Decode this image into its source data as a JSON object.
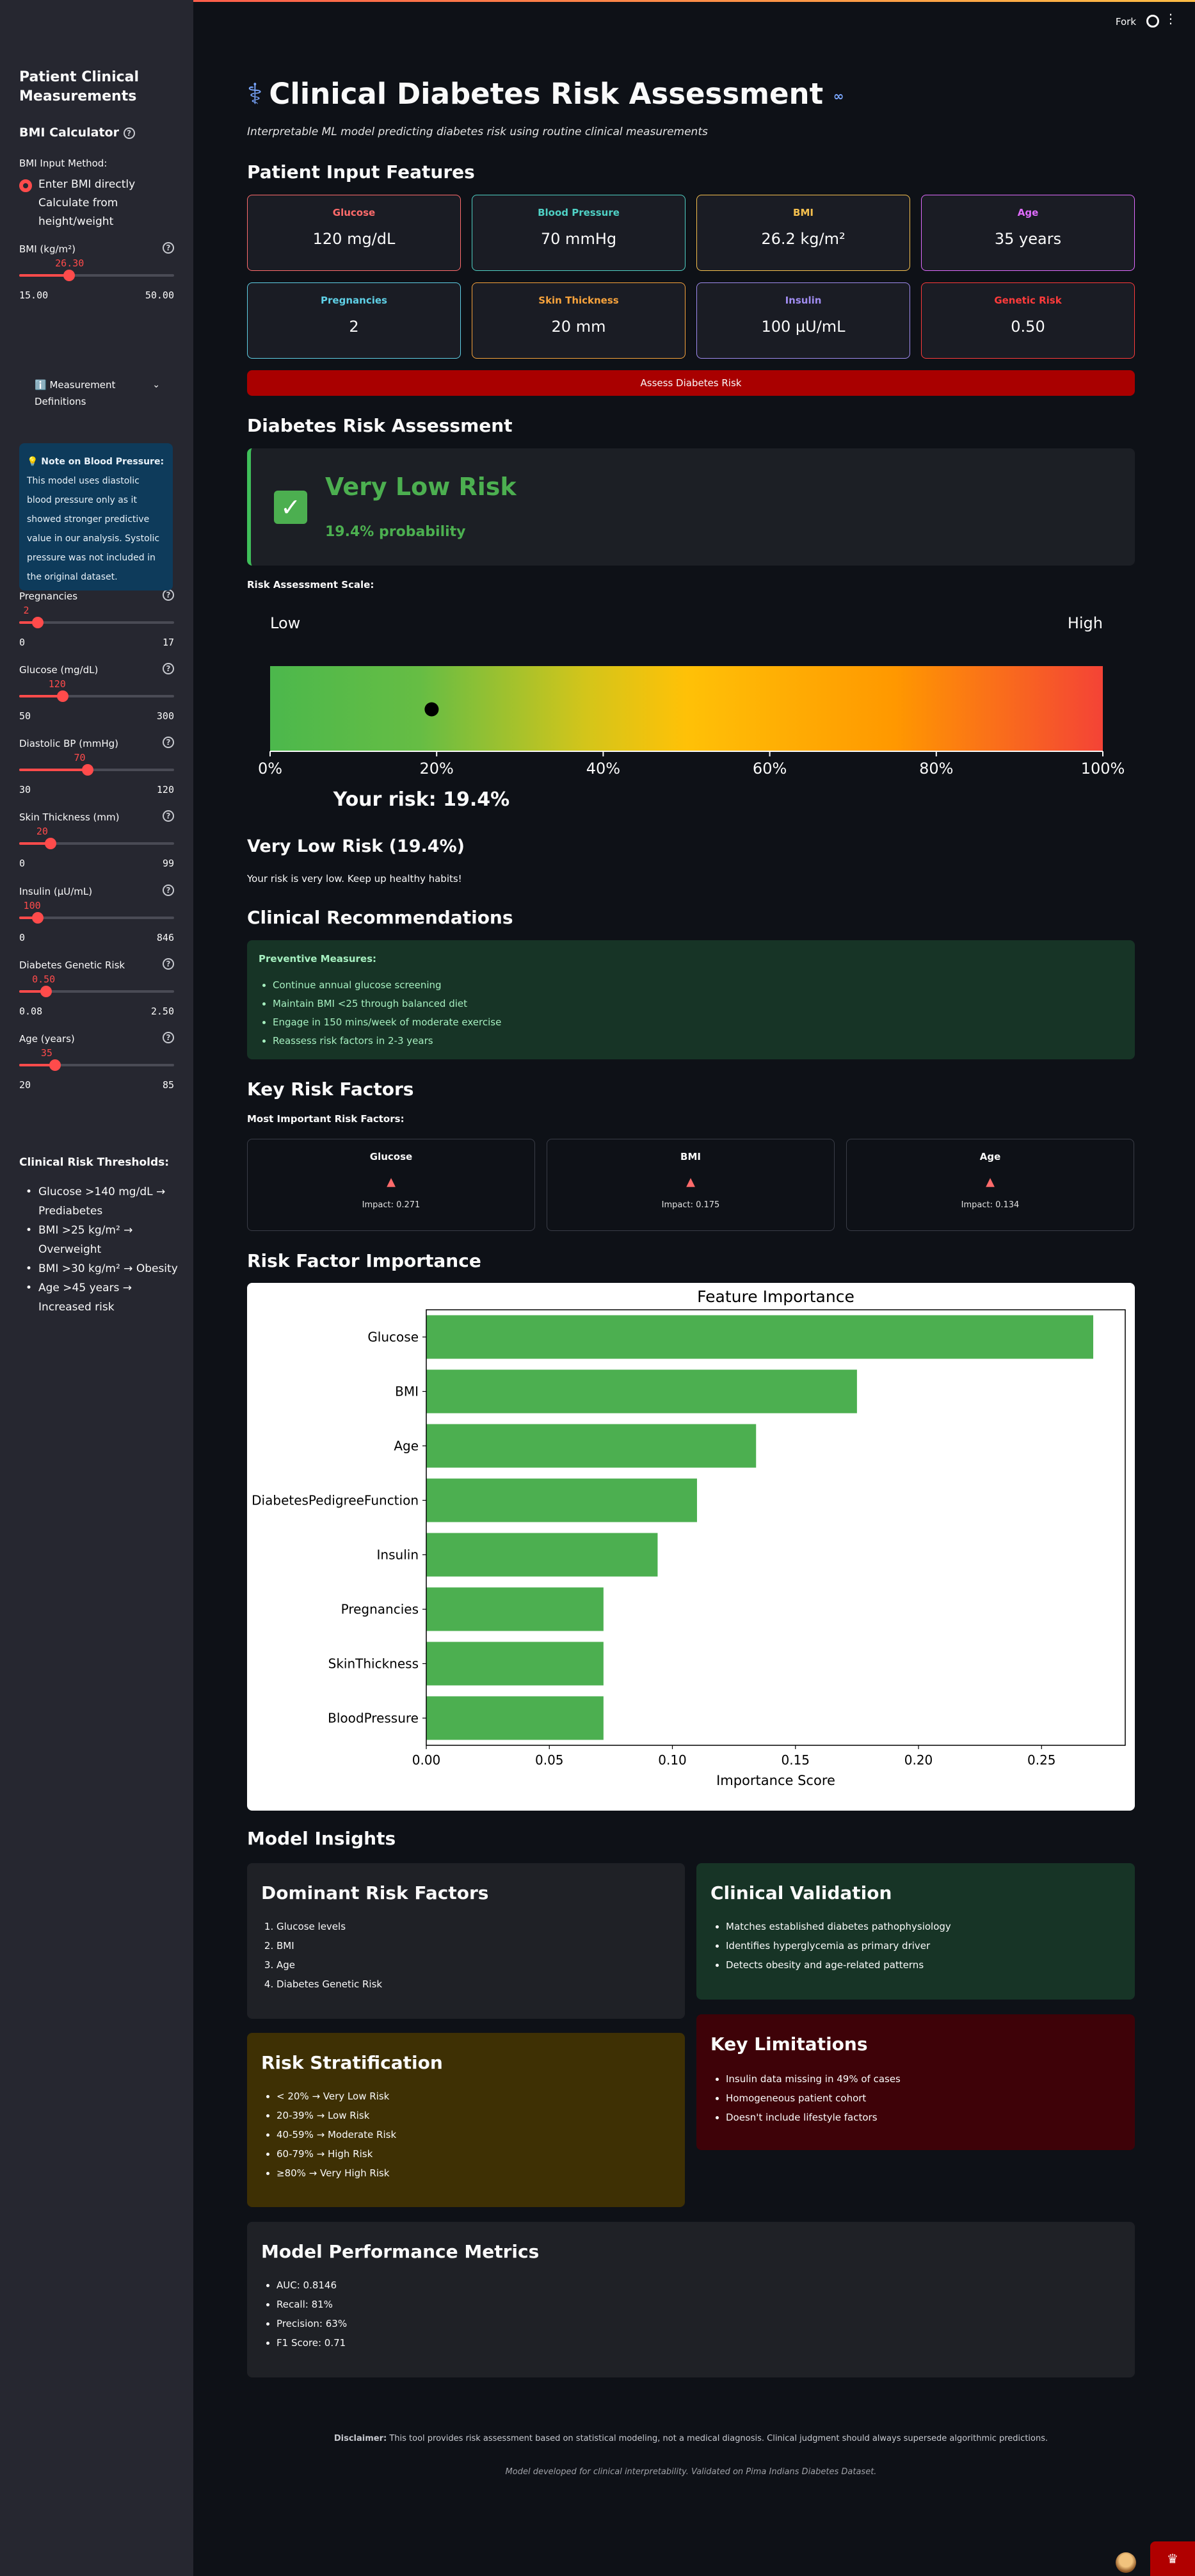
{
  "header": {
    "fork": "Fork"
  },
  "sidebar": {
    "title": "Patient Clinical Measurements",
    "bmi_calc": "BMI Calculator",
    "bmi_method_label": "BMI Input Method:",
    "bmi_options": [
      "Enter BMI directly",
      "Calculate from height/weight"
    ],
    "sliders": [
      {
        "label": "BMI (kg/m²)",
        "value": "26.30",
        "min": "15.00",
        "max": "50.00",
        "fraction": 0.323
      },
      {
        "label": "Pregnancies",
        "value": "2",
        "min": "0",
        "max": "17",
        "fraction": 0.118
      },
      {
        "label": "Glucose (mg/dL)",
        "value": "120",
        "min": "50",
        "max": "300",
        "fraction": 0.28
      },
      {
        "label": "Diastolic BP (mmHg)",
        "value": "70",
        "min": "30",
        "max": "120",
        "fraction": 0.444
      },
      {
        "label": "Skin Thickness (mm)",
        "value": "20",
        "min": "0",
        "max": "99",
        "fraction": 0.202
      },
      {
        "label": "Insulin (µU/mL)",
        "value": "100",
        "min": "0",
        "max": "846",
        "fraction": 0.118
      },
      {
        "label": "Diabetes Genetic Risk",
        "value": "0.50",
        "min": "0.08",
        "max": "2.50",
        "fraction": 0.174
      },
      {
        "label": "Age (years)",
        "value": "35",
        "min": "20",
        "max": "85",
        "fraction": 0.231
      }
    ],
    "expander_label": "ℹ️ Measurement Definitions",
    "note_title": "💡 Note on Blood Pressure:",
    "note_text": "This model uses diastolic blood pressure only as it showed stronger predictive value in our analysis. Systolic pressure was not included in the original dataset.",
    "thresholds_title": "Clinical Risk Thresholds:",
    "thresholds": [
      "Glucose >140 mg/dL → Prediabetes",
      "BMI >25 kg/m² → Overweight",
      "BMI >30 kg/m² → Obesity",
      "Age >45 years → Increased risk"
    ]
  },
  "main": {
    "title": "Clinical Diabetes Risk Assessment",
    "subtitle": "Interpretable ML model predicting diabetes risk using routine clinical measurements",
    "input_heading": "Patient Input Features",
    "features": [
      {
        "label": "Glucose",
        "value": "120 mg/dL",
        "color": "#ff6b6b"
      },
      {
        "label": "Blood Pressure",
        "value": "70 mmHg",
        "color": "#4fd1c5"
      },
      {
        "label": "BMI",
        "value": "26.2 kg/m²",
        "color": "#f6c04e"
      },
      {
        "label": "Age",
        "value": "35 years",
        "color": "#e06bff"
      },
      {
        "label": "Pregnancies",
        "value": "2",
        "color": "#5fd0e6"
      },
      {
        "label": "Skin Thickness",
        "value": "20 mm",
        "color": "#f6a23c"
      },
      {
        "label": "Insulin",
        "value": "100 µU/mL",
        "color": "#a08cf0"
      },
      {
        "label": "Genetic Risk",
        "value": "0.50",
        "color": "#ff3b3b"
      }
    ],
    "assess_button": "Assess Diabetes Risk",
    "risk_heading": "Diabetes Risk Assessment",
    "risk_level": "Very Low Risk",
    "risk_prob": "19.4% probability",
    "scale_label": "Risk Assessment Scale:",
    "scale": {
      "low": "Low",
      "high": "High",
      "ticks": [
        "0%",
        "20%",
        "40%",
        "60%",
        "80%",
        "100%"
      ],
      "risk_value": 0.194,
      "your_risk": "Your risk: 19.4%"
    },
    "summary_title": "Very Low Risk (19.4%)",
    "summary_text": "Your risk is very low. Keep up healthy habits!",
    "rec_heading": "Clinical Recommendations",
    "rec_title": "Preventive Measures:",
    "recommendations": [
      "Continue annual glucose screening",
      "Maintain BMI <25 through balanced diet",
      "Engage in 150 mins/week of moderate exercise",
      "Reassess risk factors in 2-3 years"
    ],
    "factors_heading": "Key Risk Factors",
    "factors_sub": "Most Important Risk Factors:",
    "factors": [
      {
        "name": "Glucose",
        "arrow": "▲",
        "impact": "Impact: 0.271"
      },
      {
        "name": "BMI",
        "arrow": "▲",
        "impact": "Impact: 0.175"
      },
      {
        "name": "Age",
        "arrow": "▲",
        "impact": "Impact: 0.134"
      }
    ],
    "importance_heading": "Risk Factor Importance",
    "insights_heading": "Model Insights",
    "dominant_title": "Dominant Risk Factors",
    "dominant": [
      "Glucose levels",
      "BMI",
      "Age",
      "Diabetes Genetic Risk"
    ],
    "validation_title": "Clinical Validation",
    "validation": [
      "Matches established diabetes pathophysiology",
      "Identifies hyperglycemia as primary driver",
      "Detects obesity and age-related patterns"
    ],
    "strat_title": "Risk Stratification",
    "strat": [
      "< 20% → Very Low Risk",
      "20-39% → Low Risk",
      "40-59% → Moderate Risk",
      "60-79% → High Risk",
      "≥80% → Very High Risk"
    ],
    "limit_title": "Key Limitations",
    "limits": [
      "Insulin data missing in 49% of cases",
      "Homogeneous patient cohort",
      "Doesn't include lifestyle factors"
    ],
    "perf_title": "Model Performance Metrics",
    "perf": [
      "AUC: 0.8146",
      "Recall: 81%",
      "Precision: 63%",
      "F1 Score: 0.71"
    ],
    "disclaimer_bold": "Disclaimer:",
    "disclaimer": " This tool provides risk assessment based on statistical modeling, not a medical diagnosis. Clinical judgment should always supersede algorithmic predictions.",
    "footnote": "Model developed for clinical interpretability. Validated on Pima Indians Diabetes Dataset."
  },
  "chart_data": {
    "type": "bar",
    "orientation": "horizontal",
    "title": "Feature Importance",
    "xlabel": "Importance Score",
    "ylabel": "",
    "categories": [
      "Glucose",
      "BMI",
      "Age",
      "DiabetesPedigreeFunction",
      "Insulin",
      "Pregnancies",
      "SkinThickness",
      "BloodPressure"
    ],
    "values": [
      0.271,
      0.175,
      0.134,
      0.11,
      0.094,
      0.072,
      0.072,
      0.072
    ],
    "xlim": [
      0,
      0.284
    ],
    "xticks": [
      "0.00",
      "0.05",
      "0.10",
      "0.15",
      "0.20",
      "0.25"
    ],
    "bar_color": "#4caf50",
    "grid": false
  }
}
